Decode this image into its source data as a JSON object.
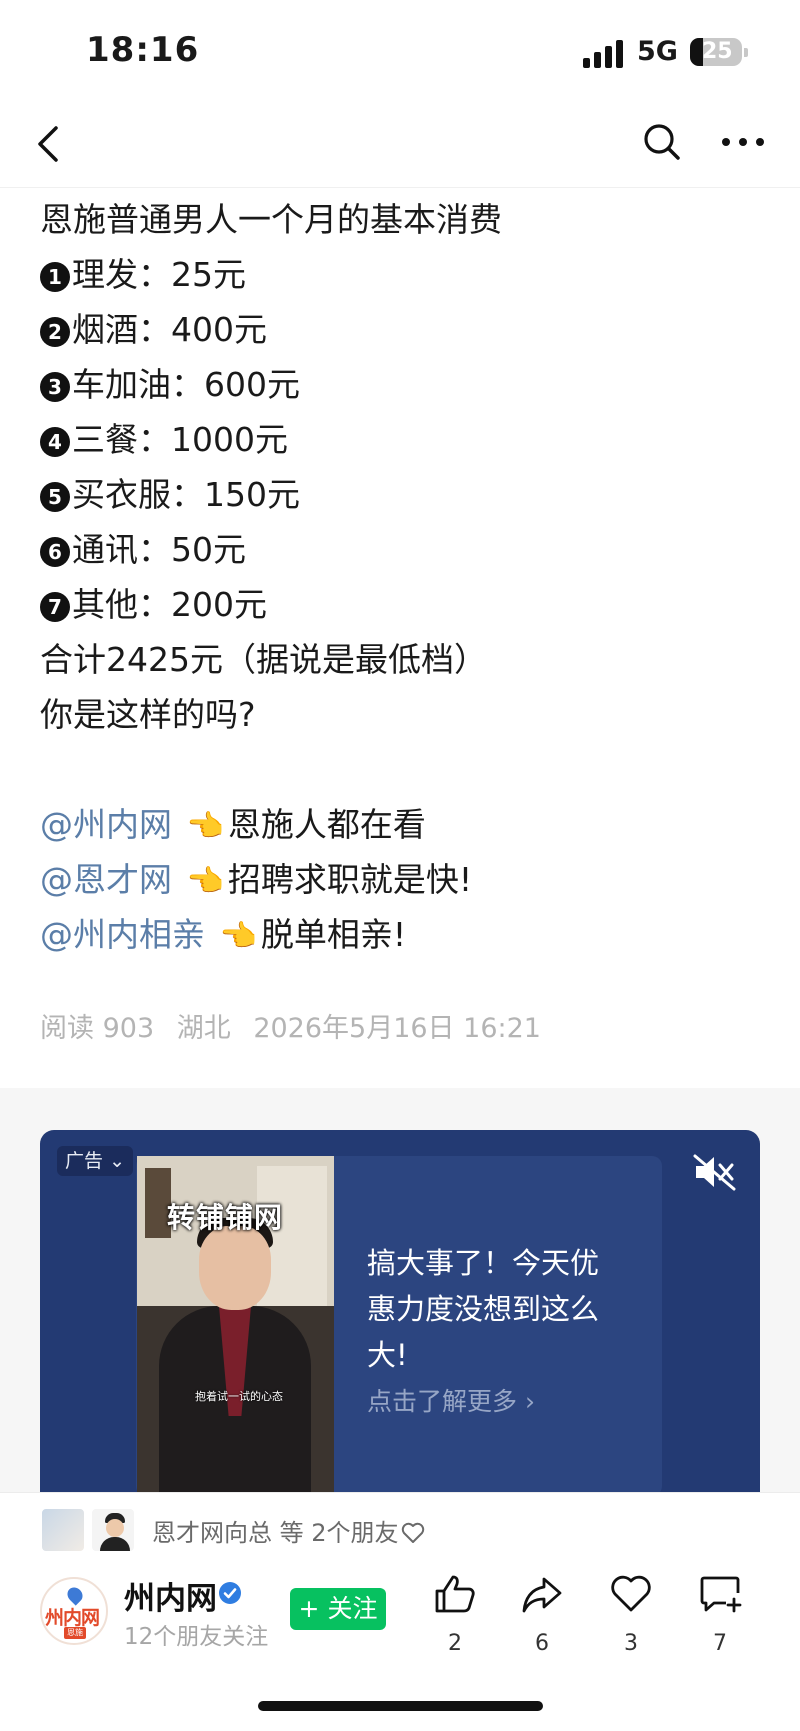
{
  "status_bar": {
    "time": "18:16",
    "network": "5G",
    "battery": "25",
    "battery_level": 0.25
  },
  "nav": {
    "back_icon": "chevron-left-icon",
    "search_icon": "search-icon",
    "more_icon": "more-dots-icon"
  },
  "article": {
    "title": "恩施普通男人一个月的基本消费",
    "items": [
      {
        "num": "1",
        "text": "理发：25元"
      },
      {
        "num": "2",
        "text": "烟酒：400元"
      },
      {
        "num": "3",
        "text": "车加油：600元"
      },
      {
        "num": "4",
        "text": "三餐：1000元"
      },
      {
        "num": "5",
        "text": "买衣服：150元"
      },
      {
        "num": "6",
        "text": "通讯：50元"
      },
      {
        "num": "7",
        "text": "其他：200元"
      }
    ],
    "total": "合计2425元（据说是最低档）",
    "question": "你是这样的吗?",
    "mentions": [
      {
        "name": "@州内网",
        "point": "👈",
        "text": "恩施人都在看"
      },
      {
        "name": "@恩才网",
        "point": "👈",
        "text": "招聘求职就是快!"
      },
      {
        "name": "@州内相亲",
        "point": "👈",
        "text": "脱单相亲!"
      }
    ],
    "meta": {
      "reads": "阅读 903",
      "location": "湖北",
      "datetime": "2026年5月16日 16:21"
    }
  },
  "ad": {
    "tag": "广告",
    "image_title": "转铺铺网",
    "image_caption": "抱着试一试的心态",
    "headline": "搞大事了！今天优惠力度没想到这么大!",
    "cta": "点击了解更多 ›",
    "colors": {
      "card": "#233a73",
      "inner": "#2c4580"
    }
  },
  "bottom": {
    "friends_text": "恩才网向总 等 2个朋友",
    "account_name": "州内网",
    "avatar_text": "州内网",
    "avatar_sub": "恩施",
    "account_sub": "12个朋友关注",
    "follow_label": "+ 关注",
    "actions": [
      {
        "icon": "thumbs-up-icon",
        "count": "2"
      },
      {
        "icon": "share-icon",
        "count": "6"
      },
      {
        "icon": "heart-icon",
        "count": "3"
      },
      {
        "icon": "comment-icon",
        "count": "7"
      }
    ],
    "colors": {
      "follow": "#07c160",
      "verified": "#2f7de1"
    }
  }
}
